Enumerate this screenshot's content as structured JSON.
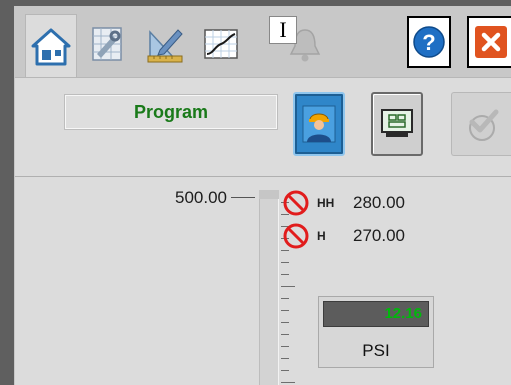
{
  "toolbar": {
    "tabs": [
      {
        "name": "home",
        "icon": "home-icon",
        "active": true
      },
      {
        "name": "engineering",
        "icon": "engineering-tools-icon",
        "active": false
      },
      {
        "name": "configuration",
        "icon": "ruler-pencil-icon",
        "active": false
      },
      {
        "name": "trends",
        "icon": "trend-chart-icon",
        "active": false
      },
      {
        "name": "alarms",
        "icon": "bell-icon",
        "active": false
      }
    ],
    "text_badge": "I",
    "help_icon": "help-icon",
    "close_icon": "close-icon"
  },
  "mode": {
    "label": "Program",
    "color": "#1a7a1a"
  },
  "commands": [
    {
      "name": "operator",
      "icon": "operator-icon",
      "color": "#2f86c9"
    },
    {
      "name": "maintenance",
      "icon": "maintenance-panel-icon"
    },
    {
      "name": "acknowledge",
      "icon": "acknowledge-icon",
      "enabled": false
    }
  ],
  "scale": {
    "max_label": "500.00"
  },
  "alarms": [
    {
      "code": "HH",
      "value": "280.00",
      "icon": "disabled-alarm-icon"
    },
    {
      "code": "H",
      "value": "270.00",
      "icon": "disabled-alarm-icon"
    }
  ],
  "pv": {
    "value": "12.16",
    "units": "PSI",
    "value_color": "#00b80c"
  }
}
